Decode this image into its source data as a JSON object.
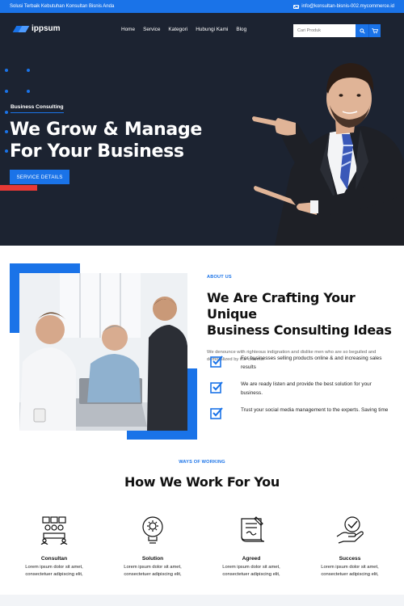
{
  "topbar": {
    "left_text": "Solusi Terbaik Kebutuhan Konsultan Bisnis Anda",
    "email": "info@konsultan-bisnis-002.mycommerce.id"
  },
  "brand": {
    "name": "ippsum"
  },
  "nav": {
    "items": [
      "Home",
      "Service",
      "Kategori",
      "Hubungi Kami",
      "Blog"
    ]
  },
  "search": {
    "placeholder": "Cari Produk"
  },
  "hero": {
    "tagline": "Business Consulting",
    "headline_line1": "We Grow & Manage",
    "headline_line2": "For Your Business",
    "cta_label": "SERVICE DETAILS"
  },
  "about": {
    "eyebrow": "ABOUT US",
    "title_line1": "We Are Crafting Your Unique",
    "title_line2": "Business Consulting Ideas",
    "description": "We denounce with righteous indignation and dislike men who are so beguiled and demoralized by the charms.",
    "features": [
      "For businesses selling products online & and increasing sales results",
      "We are ready listen and provide the best solution for your business.",
      "Trust your social media management to the experts. Saving time"
    ]
  },
  "ways": {
    "eyebrow": "WAYS OF WORKING",
    "title": "How We Work For You",
    "steps": [
      {
        "title": "Consultan",
        "icon": "meeting-icon",
        "desc_line1": "Lorem ipsum dolor sit amet,",
        "desc_line2": "consectetuer adipiscing elit,"
      },
      {
        "title": "Solution",
        "icon": "lightbulb-gear-icon",
        "desc_line1": "Lorem ipsum dolor sit amet,",
        "desc_line2": "consectetuer adipiscing elit,"
      },
      {
        "title": "Agreed",
        "icon": "contract-icon",
        "desc_line1": "Lorem ipsum dolor sit amet,",
        "desc_line2": "consectetuer adipiscing elit,"
      },
      {
        "title": "Success",
        "icon": "hand-check-icon",
        "desc_line1": "Lorem ipsum dolor sit amet,",
        "desc_line2": "consectetuer adipiscing elit,"
      }
    ]
  },
  "colors": {
    "primary": "#1a73e8",
    "hero_bg": "#1c2331",
    "accent_red": "#e53935"
  }
}
